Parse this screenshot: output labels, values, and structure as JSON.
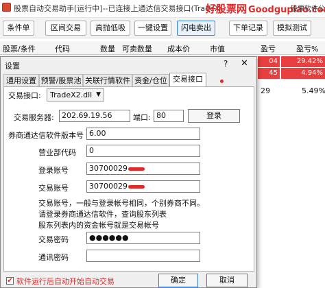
{
  "window": {
    "title": "股票自动交易助手[运行中]--已连接上通达信交易接口(TradeX)",
    "right_text": "股票软件公式"
  },
  "watermark": {
    "cn": "好股票网",
    "en": "Goodgupiao.com"
  },
  "toolbar": {
    "buttons": [
      "条件单",
      "区间交易",
      "高抛低吸",
      "一键设置",
      "闪电卖出",
      "下单记录",
      "模拟测试"
    ]
  },
  "table": {
    "headers": [
      "股票/条件",
      "代码",
      "数量",
      "可卖数量",
      "成本价",
      "市值",
      "盈亏",
      "盈亏%"
    ],
    "rows": [
      {
        "pnl": "04",
        "pct": "29.42%"
      },
      {
        "pnl": "45",
        "pct": "4.94%"
      },
      {
        "pnl": "29",
        "pct": "5.49%"
      }
    ]
  },
  "dialog": {
    "title": "设置",
    "help": "?",
    "close": "✕",
    "tabs": [
      "通用设置",
      "预警/股票池",
      "关联行情软件",
      "资金/仓位",
      "交易接口"
    ],
    "selected_tab": "交易接口",
    "interface_label": "交易接口:",
    "interface_value": "TradeX2.dll",
    "server_label": "交易服务器:",
    "server_value": "202.69.19.56",
    "port_label": "端口:",
    "port_value": "80",
    "login_button": "登录",
    "version_label": "券商通达信软件版本号",
    "version_value": "6.00",
    "branch_label": "营业部代码",
    "branch_value": "0",
    "login_account_label": "登录账号",
    "login_account_value": "30700029",
    "trade_account_label": "交易账号",
    "trade_account_value": "30700029",
    "note_lines": [
      "交易账号，一般与登录帐号相同，个别券商不同。",
      "请登录券商通达信软件，查询股东列表",
      "股东列表内的资金帐号就是交易帐号"
    ],
    "trade_password_label": "交易密码",
    "trade_password_value": "●●●●●●",
    "comm_password_label": "通讯密码",
    "comm_password_value": "",
    "autostart_label": "软件运行后自动开始自动交易",
    "autostart_checked": true,
    "ok_button": "确定",
    "cancel_button": "取消"
  },
  "colors": {
    "accent_red": "#e02a2a",
    "positive_bg": "#e84040",
    "focus_blue": "#3a7bd5"
  }
}
